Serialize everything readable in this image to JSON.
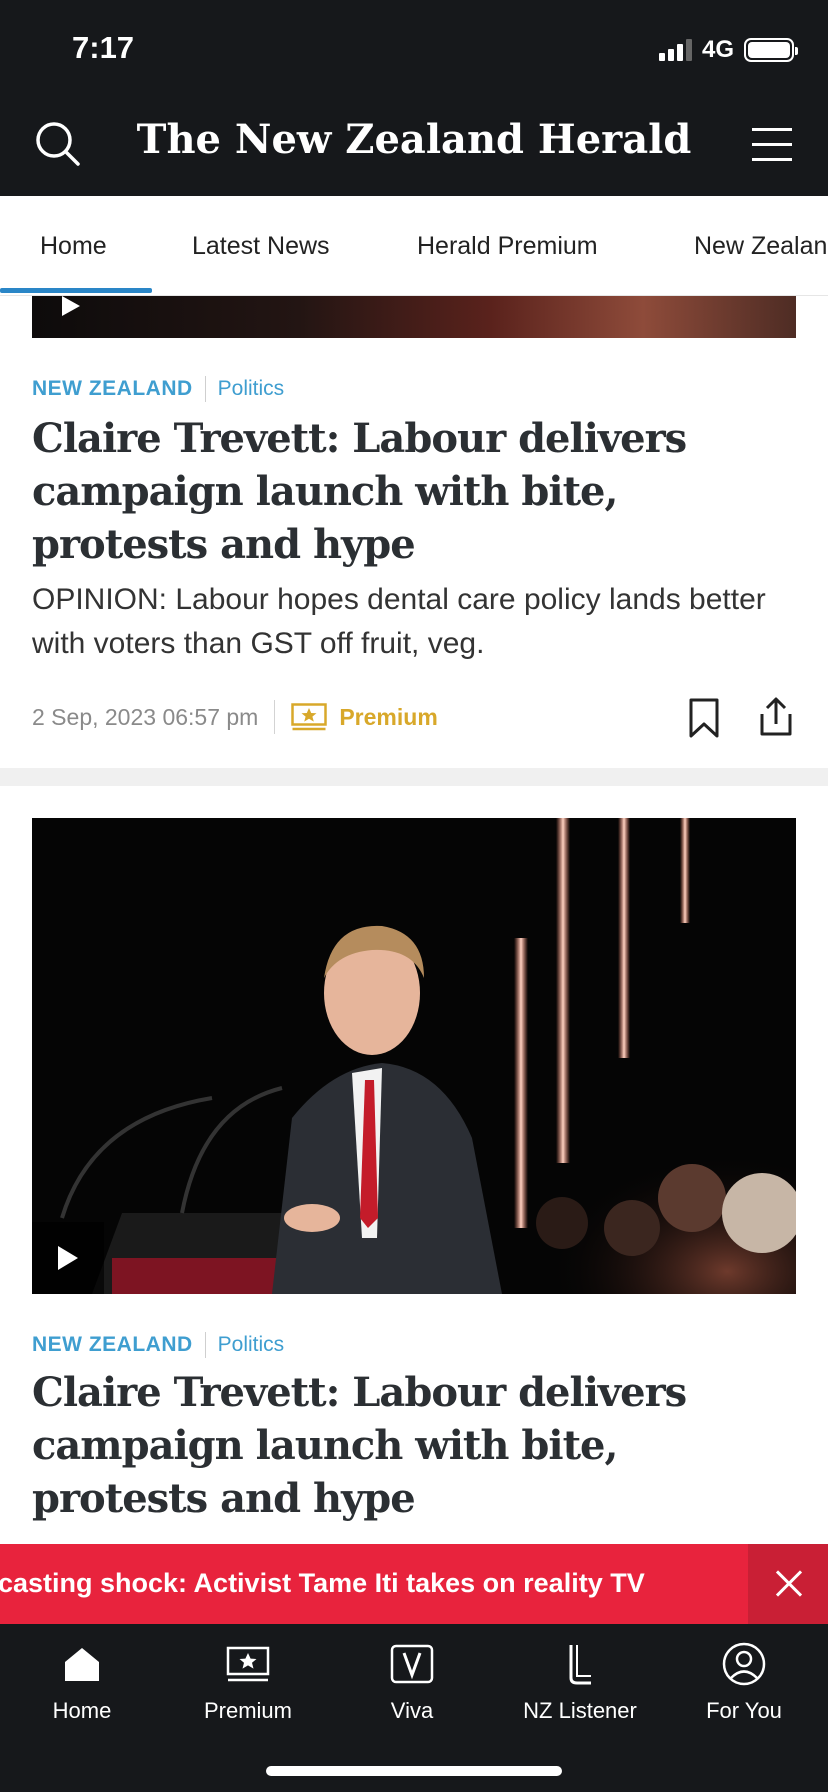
{
  "status_bar": {
    "time": "7:17",
    "network": "4G"
  },
  "header": {
    "logo": "The New Zealand Herald"
  },
  "tabs": [
    {
      "label": "Home",
      "active": true
    },
    {
      "label": "Latest News"
    },
    {
      "label": "Herald Premium"
    },
    {
      "label": "New Zealand"
    }
  ],
  "articles": [
    {
      "section": "NEW ZEALAND",
      "subsection": "Politics",
      "headline": "Claire Trevett: Labour delivers campaign launch with bite, protests and hype",
      "summary": "OPINION: Labour hopes dental care policy lands better with voters than GST off fruit, veg.",
      "date": "2 Sep, 2023 06:57 pm",
      "badge": "Premium"
    },
    {
      "section": "NEW ZEALAND",
      "subsection": "Politics",
      "headline": "Claire Trevett: Labour delivers campaign launch with bite, protests and hype"
    }
  ],
  "breaking_banner": {
    "text": "casting shock: Activist Tame Iti takes on reality TV"
  },
  "bottom_nav": [
    {
      "label": "Home",
      "icon": "home-icon"
    },
    {
      "label": "Premium",
      "icon": "premium-star-icon"
    },
    {
      "label": "Viva",
      "icon": "viva-icon"
    },
    {
      "label": "NZ Listener",
      "icon": "listener-icon"
    },
    {
      "label": "For You",
      "icon": "user-profile-icon"
    }
  ],
  "colors": {
    "header_bg": "#16181b",
    "section_blue": "#3f9ed0",
    "premium_gold": "#d8a82a",
    "banner_red": "#e8233d",
    "tab_underline": "#2a86c7"
  }
}
